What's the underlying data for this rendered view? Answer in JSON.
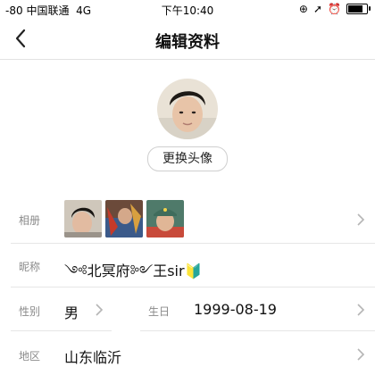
{
  "status_bar": {
    "signal": "-80",
    "carrier": "中国联通",
    "network": "4G",
    "time": "下午10:40",
    "battery_level": 0.85
  },
  "nav": {
    "title": "编辑资料",
    "back_icon": "chevron-left-icon"
  },
  "profile": {
    "change_avatar_label": "更换头像"
  },
  "album": {
    "label": "相册",
    "photos": [
      {
        "name": "album-photo-1"
      },
      {
        "name": "album-photo-2"
      },
      {
        "name": "album-photo-3"
      }
    ]
  },
  "nickname": {
    "label": "昵称",
    "value": "༺北冥府༻王sir🔰"
  },
  "gender": {
    "label": "性别",
    "value": "男"
  },
  "birthday": {
    "label": "生日",
    "value": "1999-08-19"
  },
  "region": {
    "label": "地区",
    "value": "山东临沂"
  },
  "colors": {
    "label_gray": "#8a8a8a",
    "divider": "#e6e6e6",
    "chevron": "#b5b5b5"
  }
}
